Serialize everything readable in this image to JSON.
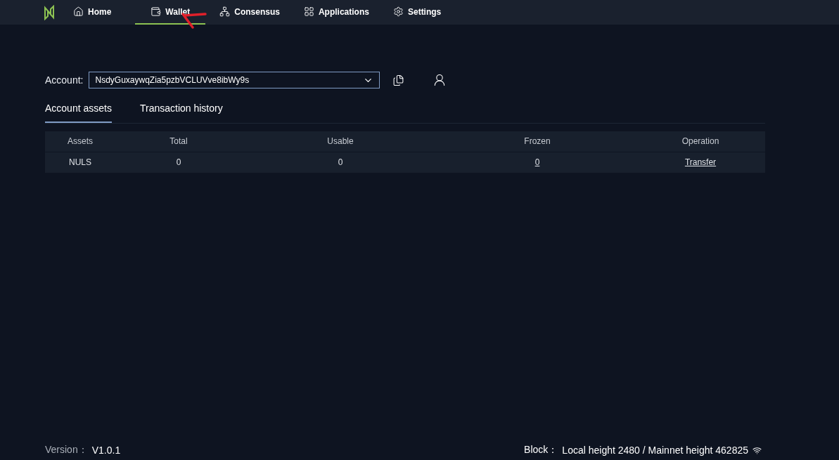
{
  "nav": {
    "items": [
      {
        "label": "Home",
        "selected": false
      },
      {
        "label": "Wallet",
        "selected": true
      },
      {
        "label": "Consensus",
        "selected": false
      },
      {
        "label": "Applications",
        "selected": false
      },
      {
        "label": "Settings",
        "selected": false
      }
    ]
  },
  "account": {
    "label": "Account:",
    "value": "NsdyGuxaywqZia5pzbVCLUVve8ibWy9s"
  },
  "tabs": [
    {
      "label": "Account assets",
      "selected": true
    },
    {
      "label": "Transaction history",
      "selected": false
    }
  ],
  "table": {
    "columns": [
      "Assets",
      "Total",
      "Usable",
      "Frozen",
      "Operation"
    ],
    "rows": [
      {
        "cells": [
          {
            "text": "NULS",
            "kind": "text"
          },
          {
            "text": "0",
            "kind": "text"
          },
          {
            "text": "0",
            "kind": "text"
          },
          {
            "text": "0",
            "kind": "link"
          },
          {
            "text": "Transfer",
            "kind": "link"
          }
        ]
      }
    ]
  },
  "footer": {
    "version_label": "Version：",
    "version": "V1.0.1",
    "block_label": "Block：",
    "block": "Local height 2480 / Mainnet height 462825"
  }
}
